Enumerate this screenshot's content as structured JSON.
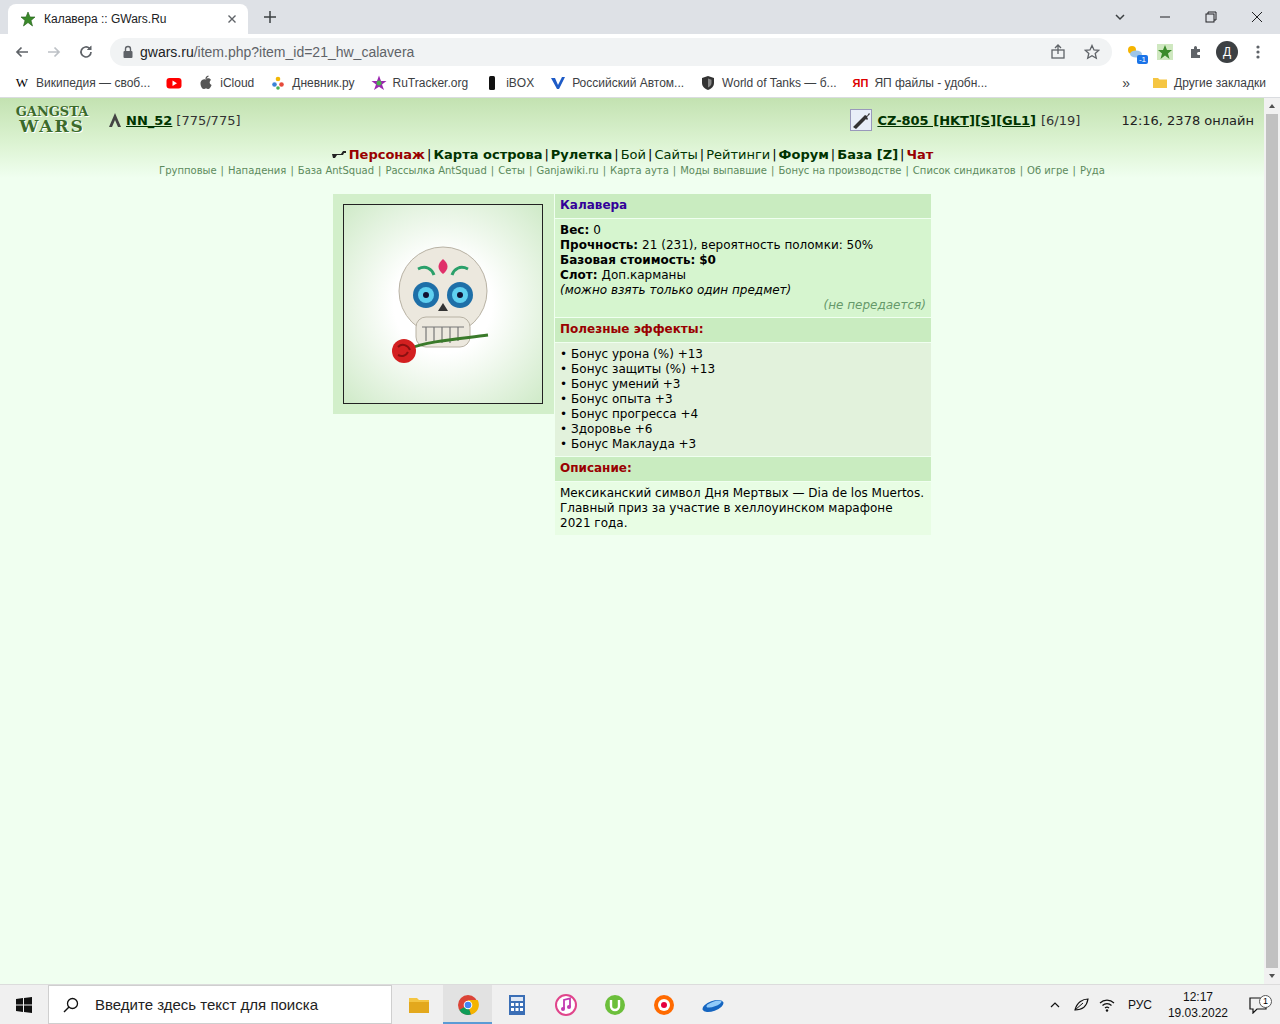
{
  "window": {
    "title": "Калавера :: GWars.Ru"
  },
  "tabs": [
    {
      "label": "Калавера :: GWars.Ru",
      "selected": true
    }
  ],
  "toolbar": {
    "address_host": "gwars.ru",
    "address_path": "/item.php?item_id=21_hw_calavera",
    "extension_badge": "-1",
    "profile": "Д"
  },
  "bookmarks": [
    {
      "kind": "glyph",
      "glyph": "W",
      "label": "Википедия — своб..."
    },
    {
      "kind": "icon-only"
    },
    {
      "kind": "link",
      "label": "iCloud"
    },
    {
      "kind": "link",
      "label": "Дневник.ру"
    },
    {
      "kind": "link",
      "label": "RuTracker.org"
    },
    {
      "kind": "link",
      "label": "iBOX"
    },
    {
      "kind": "link",
      "label": "Российский Автом..."
    },
    {
      "kind": "link",
      "label": "World of Tanks — б..."
    },
    {
      "kind": "glyph",
      "glyph": "ЯП",
      "label": "ЯП файлы - удобн..."
    }
  ],
  "bookmarks_overflow": "»",
  "other_bookmarks": "Другие закладки",
  "page": {
    "logo": [
      "GANGSTA",
      "WARS"
    ],
    "user": "NN_52",
    "hp": "[775/775]",
    "weapon": "CZ-805 [HKT][S][GL1]",
    "ammo": "[6/19]",
    "clock": "12:16, 2378 онлайн",
    "separator": "|",
    "nav": [
      {
        "label": "Персонаж",
        "kind": "accent"
      },
      {
        "label": "Карта острова",
        "kind": "bold"
      },
      {
        "label": "Рулетка",
        "kind": "bold"
      },
      {
        "label": "Бой",
        "kind": "plain"
      },
      {
        "label": "Сайты",
        "kind": "plain"
      },
      {
        "label": "Рейтинги",
        "kind": "plain"
      },
      {
        "label": "Форум",
        "kind": "bold"
      },
      {
        "label": "База [Z]",
        "kind": "bold"
      },
      {
        "label": "Чат",
        "kind": "accent"
      }
    ],
    "subnav": [
      "Групповые",
      "Нападения",
      "База AntSquad",
      "Рассылка AntSquad",
      "Сеты",
      "Ganjawiki.ru",
      "Карта аута",
      "Моды выпавшие",
      "Бонус на производстве",
      "Список синдикатов",
      "Об игре",
      "Руда"
    ]
  },
  "item": {
    "name": "Калавера",
    "stats": [
      {
        "label": "Вес:",
        "value": "0",
        "kind": "plain"
      },
      {
        "label": "Прочность:",
        "value": "21 (231), вероятность поломки: 50%",
        "kind": "plain"
      },
      {
        "label": "Базовая стоимость:",
        "value": "$0",
        "kind": "bold"
      },
      {
        "label": "Слот:",
        "value": "Доп.карманы",
        "kind": "plain"
      }
    ],
    "note": "(можно взять только один предмет)",
    "transfer": "(не передается)",
    "effects_title": "Полезные эффекты:",
    "bullet": "•",
    "effects": [
      "Бонус урона (%) +13",
      "Бонус защиты (%) +13",
      "Бонус умений +3",
      "Бонус опыта +3",
      "Бонус прогресса +4",
      "Здоровье +6",
      "Бонус Маклауда +3"
    ],
    "description_title": "Описание:",
    "description": "Мексиканский символ Дня Мертвых — Dia de los Muertos. Главный приз за участие в хеллоуинском марафоне 2021 года."
  },
  "taskbar": {
    "search_placeholder": "Введите здесь текст для поиска",
    "language": "РУС",
    "time": "12:17",
    "date": "19.03.2022",
    "notifications": "1"
  }
}
